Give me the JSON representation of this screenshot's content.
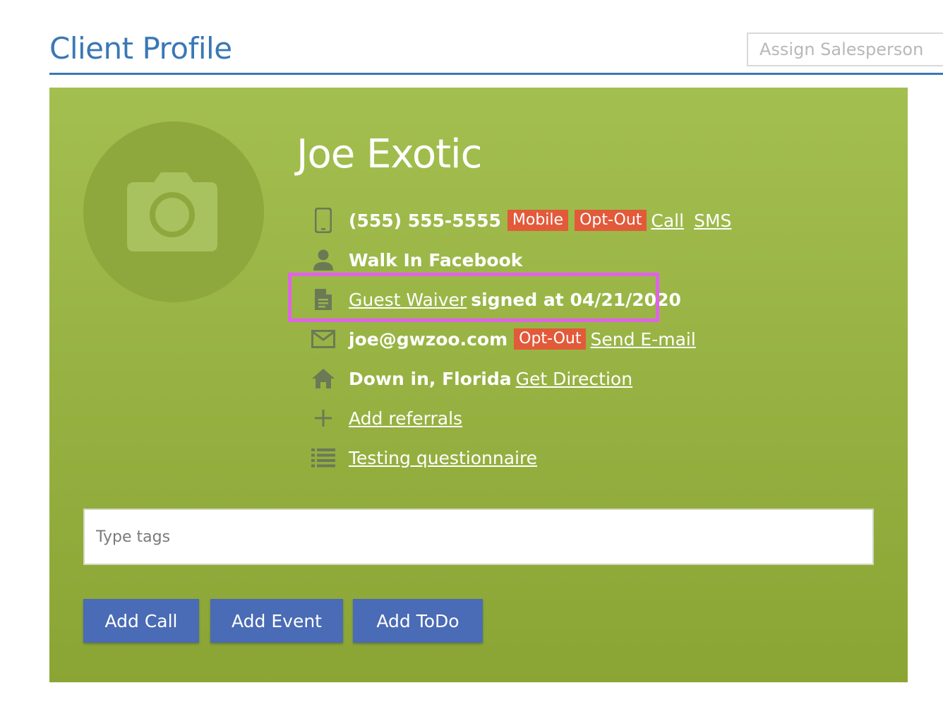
{
  "header": {
    "title": "Client Profile",
    "assign_placeholder": "Assign Salesperson"
  },
  "client": {
    "name": "Joe Exotic",
    "avatar_icon": "camera-icon"
  },
  "info": {
    "phone": {
      "icon": "mobile-phone-icon",
      "number": "(555) 555-5555",
      "badge_type": "Mobile",
      "badge_optout": "Opt-Out",
      "call_link": "Call",
      "sms_link": "SMS"
    },
    "source": {
      "icon": "person-icon",
      "text": "Walk In Facebook"
    },
    "waiver": {
      "icon": "document-icon",
      "link": "Guest Waiver",
      "text": "signed at 04/21/2020"
    },
    "email": {
      "icon": "envelope-icon",
      "address": "joe@gwzoo.com",
      "badge_optout": "Opt-Out",
      "send_link": "Send E-mail"
    },
    "address": {
      "icon": "home-icon",
      "text": "Down in, Florida",
      "direction_link": "Get Direction"
    },
    "referrals": {
      "icon": "plus-icon",
      "link": "Add referrals"
    },
    "questionnaire": {
      "icon": "list-icon",
      "link": "Testing questionnaire"
    }
  },
  "tags": {
    "placeholder": "Type tags"
  },
  "actions": {
    "add_call": "Add Call",
    "add_event": "Add Event",
    "add_todo": "Add ToDo"
  },
  "colors": {
    "title_blue": "#3a78b5",
    "card_green_top": "#a3bf4f",
    "card_green_bottom": "#8ba535",
    "badge_red": "#e25a3a",
    "button_blue": "#4a6bb5",
    "highlight_magenta": "#e062e8",
    "icon_gray": "#6b7a55"
  }
}
